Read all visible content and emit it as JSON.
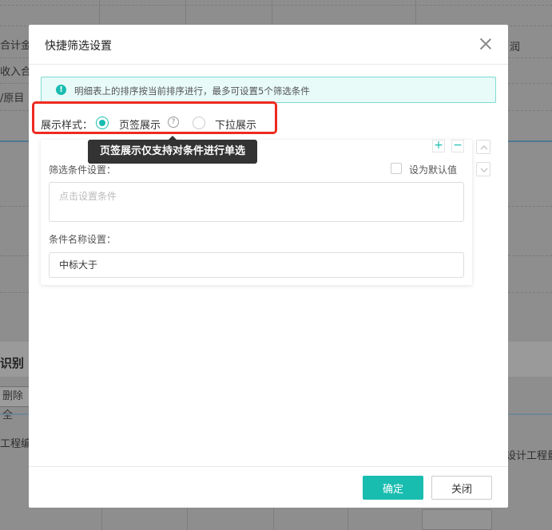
{
  "background": {
    "left_labels": [
      "合计金",
      "收入合",
      "/原目"
    ],
    "right_label_top": "润",
    "section_title": "识别",
    "delete_button": "删除全",
    "column_left": "工程编",
    "column_right": "设计工程量"
  },
  "modal": {
    "title": "快捷筛选设置",
    "notice": "明细表上的排序按当前排序进行，最多可设置5个筛选条件",
    "style_label": "展示样式：",
    "option_tab": "页签展示",
    "option_dropdown": "下拉展示",
    "tooltip": "页签展示仅支持对条件进行单选",
    "card": {
      "add": "+",
      "remove": "−",
      "condition_label": "筛选条件设置：",
      "default_label": "设为默认值",
      "condition_placeholder": "点击设置条件",
      "name_label": "条件名称设置：",
      "name_value": "中标大于"
    },
    "ok_label": "确定",
    "close_label": "关闭"
  },
  "colors": {
    "accent": "#19bdb0",
    "highlight": "#ee2a1f",
    "tooltip_bg": "#333333"
  }
}
